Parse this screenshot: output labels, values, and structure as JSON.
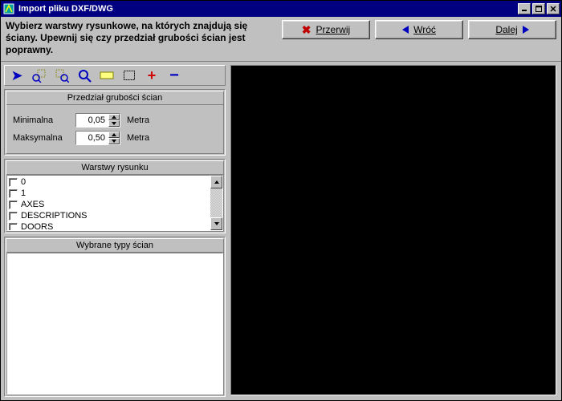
{
  "window": {
    "title": "Import pliku DXF/DWG"
  },
  "instruction": "Wybierz warstwy rysunkowe, na których znajdują się ściany. Upewnij się czy przedział grubości ścian jest poprawny.",
  "nav": {
    "cancel": "Przerwij",
    "back": "Wróć",
    "next": "Dalej"
  },
  "toolbar": {
    "pointer": "↖",
    "zoom_in_area": "⧉",
    "zoom_out_area": "⧈",
    "zoom": "🔍",
    "fit": "▭",
    "select_rect": "◻",
    "plus": "+",
    "minus": "−"
  },
  "thickness": {
    "header": "Przedział grubości ścian",
    "min_label": "Minimalna",
    "min_value": "0,05",
    "max_label": "Maksymalna",
    "max_value": "0,50",
    "unit": "Metra"
  },
  "layers": {
    "header": "Warstwy rysunku",
    "items": [
      "0",
      "1",
      "AXES",
      "DESCRIPTIONS",
      "DOORS"
    ]
  },
  "walltypes": {
    "header": "Wybrane typy ścian"
  }
}
